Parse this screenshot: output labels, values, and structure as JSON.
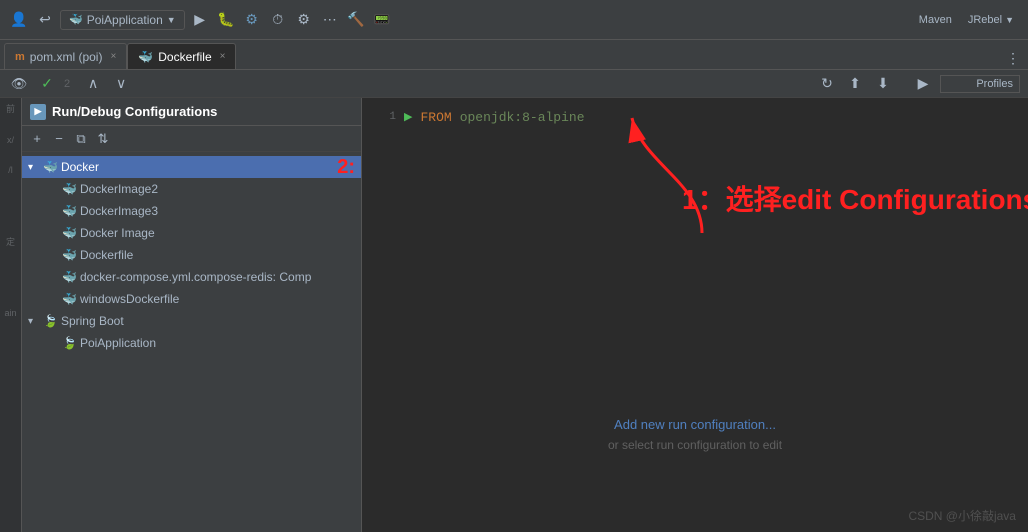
{
  "toolbar": {
    "title": "PoiApplication",
    "run_label": "▶",
    "debug_label": "🐛",
    "maven_label": "Maven",
    "profiles_label": "Profiles",
    "jrebel_label": "JRebel",
    "dropdown_arrow": "▼"
  },
  "tabs": [
    {
      "id": "pom",
      "label": "pom.xml (poi)",
      "icon": "m",
      "active": false
    },
    {
      "id": "dockerfile",
      "label": "Dockerfile",
      "icon": "🐳",
      "active": true
    }
  ],
  "code": {
    "line1_num": "1",
    "line1_keyword": "FROM",
    "line1_value": "openjdk:8-alpine"
  },
  "dialog": {
    "title": "Run/Debug Configurations",
    "toolbar_add": "+",
    "toolbar_remove": "−",
    "toolbar_copy": "⧉",
    "toolbar_sort": "⇅",
    "tree": {
      "groups": [
        {
          "id": "docker",
          "label": "Docker",
          "icon": "🐳",
          "selected": true,
          "expanded": true,
          "children": [
            {
              "id": "dockerimage2",
              "label": "DockerImage2",
              "icon": "🐳"
            },
            {
              "id": "dockerimage3",
              "label": "DockerImage3",
              "icon": "🐳"
            },
            {
              "id": "dockerimage",
              "label": "Docker Image",
              "icon": "🐳"
            },
            {
              "id": "dockerfilechild",
              "label": "Dockerfile",
              "icon": "🐳"
            },
            {
              "id": "dockercompose",
              "label": "docker-compose.yml.compose-redis: Comp",
              "icon": "🐳"
            },
            {
              "id": "windowsdockerfile",
              "label": "windowsDockerfile",
              "icon": "🐳"
            }
          ]
        },
        {
          "id": "springboot",
          "label": "Spring Boot",
          "icon": "🍃",
          "expanded": true,
          "children": [
            {
              "id": "poiapplication",
              "label": "PoiApplication",
              "icon": "🍃"
            }
          ]
        }
      ]
    }
  },
  "annotations": {
    "text1": "1：选择edit Configurations",
    "text2": "2:"
  },
  "center": {
    "add_config": "Add new run configuration...",
    "hint": "or select run configuration to edit"
  },
  "watermark": "CSDN @小徐敲java"
}
